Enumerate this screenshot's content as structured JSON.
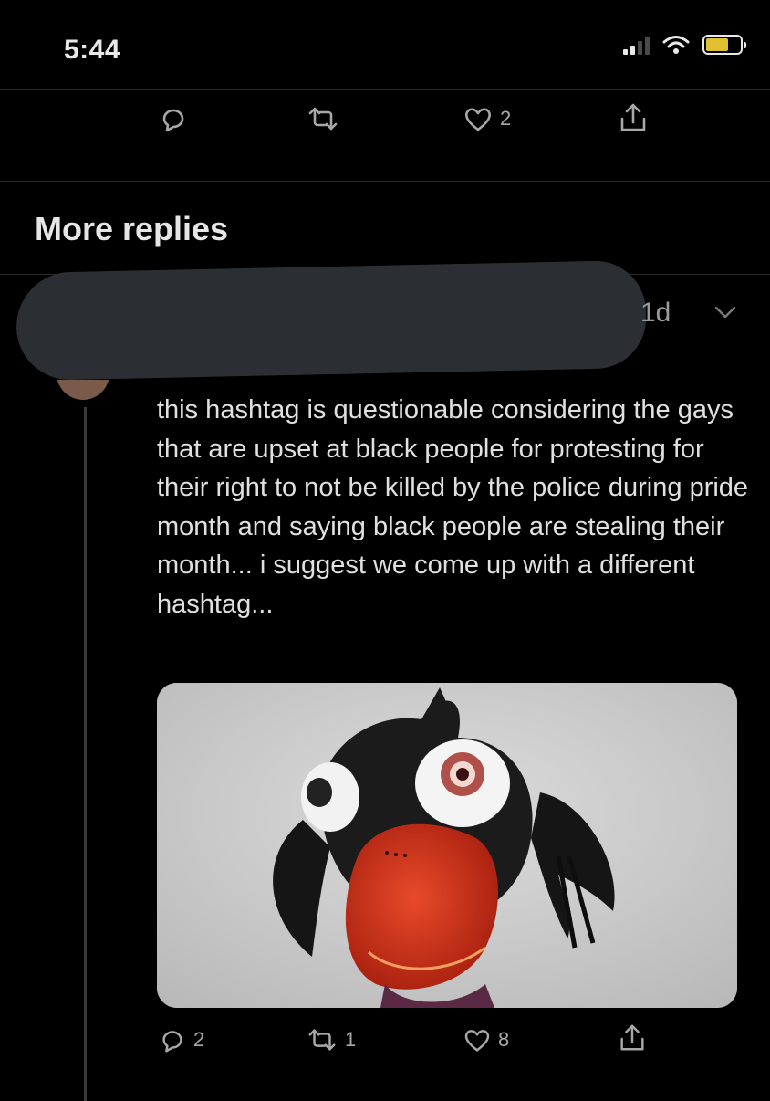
{
  "status_bar": {
    "time": "5:44"
  },
  "top_actions": {
    "like_count": "2"
  },
  "section": {
    "title": "More replies"
  },
  "reply": {
    "time_ago": "1d",
    "text": "this hashtag is questionable considering the gays that are upset at black people for protesting for their right to not be killed by the police during pride month and saying black people are stealing their month... i suggest we come up with a different hashtag...",
    "reply_count": "2",
    "retweet_count": "1",
    "like_count": "8"
  },
  "icons": [
    "signal-icon",
    "wifi-icon",
    "battery-icon",
    "reply-icon",
    "retweet-icon",
    "like-icon",
    "share-icon",
    "chevron-down-icon"
  ],
  "colors": {
    "background": "#000000",
    "text": "#e0e0e0",
    "muted": "#a8a8a8",
    "battery": "#e0c030",
    "redaction": "#2b2f33"
  }
}
